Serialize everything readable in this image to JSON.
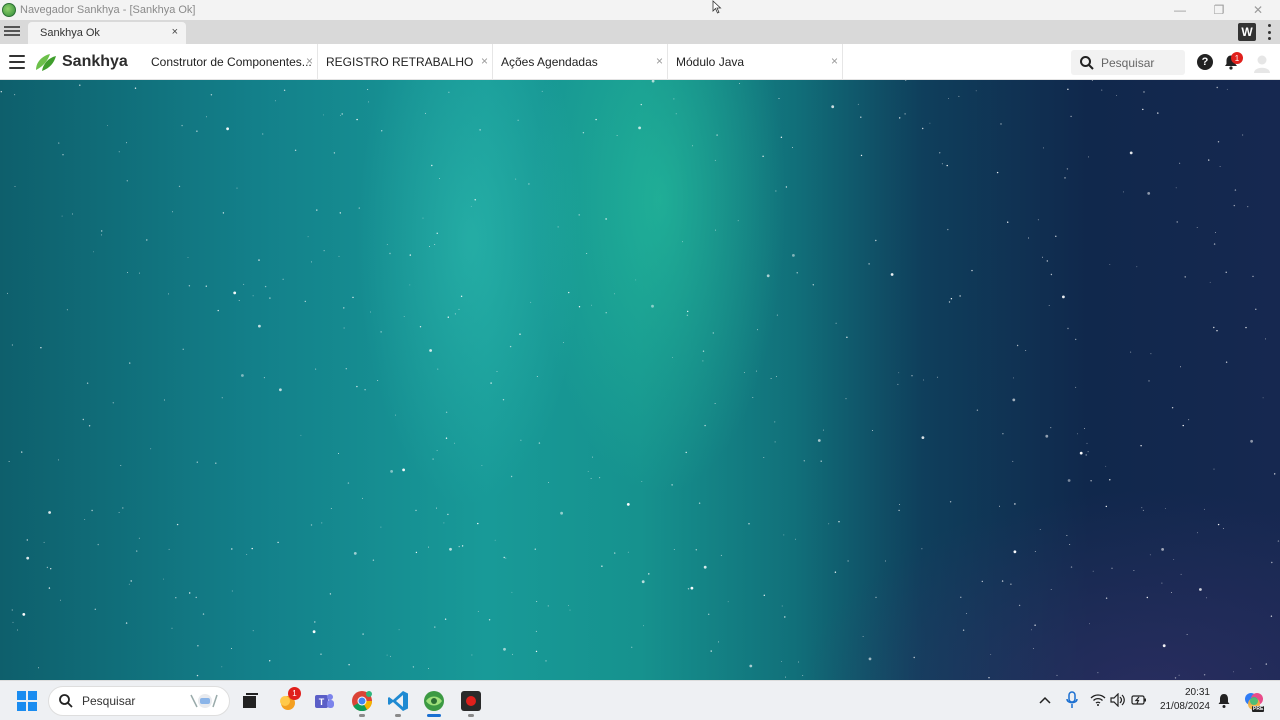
{
  "window": {
    "title": "Navegador Sankhya - [Sankhya Ok]",
    "minimize": "—",
    "maximize": "❐",
    "close": "✕"
  },
  "browser": {
    "tab_label": "Sankhya Ok",
    "tab_close": "×",
    "extension_label": "W"
  },
  "app": {
    "brand": "Sankhya",
    "tabs": [
      {
        "label": "Construtor de Componentes...",
        "close": "×"
      },
      {
        "label": "REGISTRO RETRABALHO",
        "close": "×"
      },
      {
        "label": "Ações Agendadas",
        "close": "×"
      },
      {
        "label": "Módulo Java",
        "close": "×"
      }
    ],
    "search_placeholder": "Pesquisar",
    "help_label": "?",
    "notification_count": "1"
  },
  "taskbar": {
    "search_label": "Pesquisar",
    "time": "20:31",
    "date": "21/08/2024",
    "app_badge": "1",
    "copilot_label": "PRE"
  },
  "colors": {
    "brand_green": "#4caf2a",
    "badge_red": "#e0201c",
    "windows_blue": "#1a8cf0"
  }
}
